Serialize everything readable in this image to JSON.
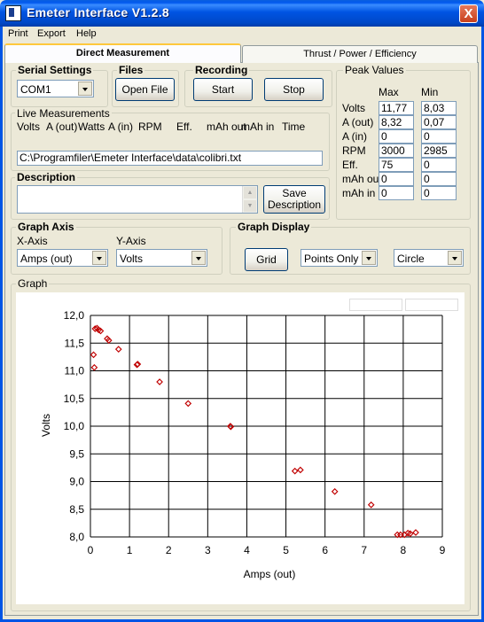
{
  "window": {
    "title": "Emeter Interface V1.2.8",
    "close_glyph": "X",
    "icon": "app-icon"
  },
  "menu": {
    "print": "Print",
    "export": "Export",
    "help": "Help"
  },
  "tabs": {
    "direct": "Direct Measurement",
    "thrust": "Thrust / Power / Efficiency"
  },
  "serial": {
    "title": "Serial Settings",
    "port": "COM1"
  },
  "files": {
    "title": "Files",
    "open_label": "Open File"
  },
  "recording": {
    "title": "Recording",
    "start_label": "Start",
    "stop_label": "Stop"
  },
  "live": {
    "title": "Live Measurements",
    "headers": [
      "Volts",
      "A (out)",
      "Watts",
      "A (in)",
      "RPM",
      "Eff.",
      "mAh out",
      "mAh in",
      "Time"
    ],
    "path": "C:\\Programfiler\\Emeter Interface\\data\\colibri.txt"
  },
  "description": {
    "title": "Description",
    "text": "",
    "save_label_1": "Save",
    "save_label_2": "Description"
  },
  "peak": {
    "title": "Peak Values",
    "max_header": "Max",
    "min_header": "Min",
    "rows": [
      {
        "label": "Volts",
        "max": "11,77",
        "min": "8,03"
      },
      {
        "label": "A (out)",
        "max": "8,32",
        "min": "0,07"
      },
      {
        "label": "A (in)",
        "max": "0",
        "min": "0"
      },
      {
        "label": "RPM",
        "max": "3000",
        "min": "2985"
      },
      {
        "label": "Eff.",
        "max": "75",
        "min": "0"
      },
      {
        "label": "mAh out",
        "max": "0",
        "min": "0"
      },
      {
        "label": "mAh in",
        "max": "0",
        "min": "0"
      }
    ]
  },
  "graph_axis": {
    "title": "Graph Axis",
    "x_label": "X-Axis",
    "x_value": "Amps (out)",
    "y_label": "Y-Axis",
    "y_value": "Volts"
  },
  "graph_display": {
    "title": "Graph Display",
    "grid_label": "Grid",
    "mode": "Points Only",
    "marker": "Circle"
  },
  "graph": {
    "title": "Graph"
  },
  "colors": {
    "points": "#C00000",
    "grid": "#000000",
    "accent": "#0054E3"
  },
  "chart_data": {
    "type": "scatter",
    "xlabel": "Amps (out)",
    "ylabel": "Volts",
    "xlim": [
      0,
      9
    ],
    "ylim": [
      8.0,
      12.0
    ],
    "x_ticks": [
      "0",
      "1",
      "2",
      "3",
      "4",
      "5",
      "6",
      "7",
      "8",
      "9"
    ],
    "y_ticks": [
      "8,0",
      "8,5",
      "9,0",
      "9,5",
      "10,0",
      "10,5",
      "11,0",
      "11,5",
      "12,0"
    ],
    "grid": true,
    "points": [
      [
        0.08,
        11.29
      ],
      [
        0.1,
        11.06
      ],
      [
        0.12,
        11.76
      ],
      [
        0.17,
        11.77
      ],
      [
        0.21,
        11.74
      ],
      [
        0.26,
        11.72
      ],
      [
        0.43,
        11.58
      ],
      [
        0.47,
        11.55
      ],
      [
        0.72,
        11.39
      ],
      [
        1.19,
        11.11
      ],
      [
        1.21,
        11.12
      ],
      [
        1.77,
        10.8
      ],
      [
        2.5,
        10.41
      ],
      [
        3.58,
        10.0
      ],
      [
        3.59,
        9.99
      ],
      [
        5.23,
        9.19
      ],
      [
        5.37,
        9.21
      ],
      [
        6.25,
        8.82
      ],
      [
        7.18,
        8.58
      ],
      [
        7.85,
        8.04
      ],
      [
        7.93,
        8.04
      ],
      [
        8.03,
        8.04
      ],
      [
        8.12,
        8.07
      ],
      [
        8.18,
        8.06
      ],
      [
        8.32,
        8.08
      ]
    ]
  }
}
